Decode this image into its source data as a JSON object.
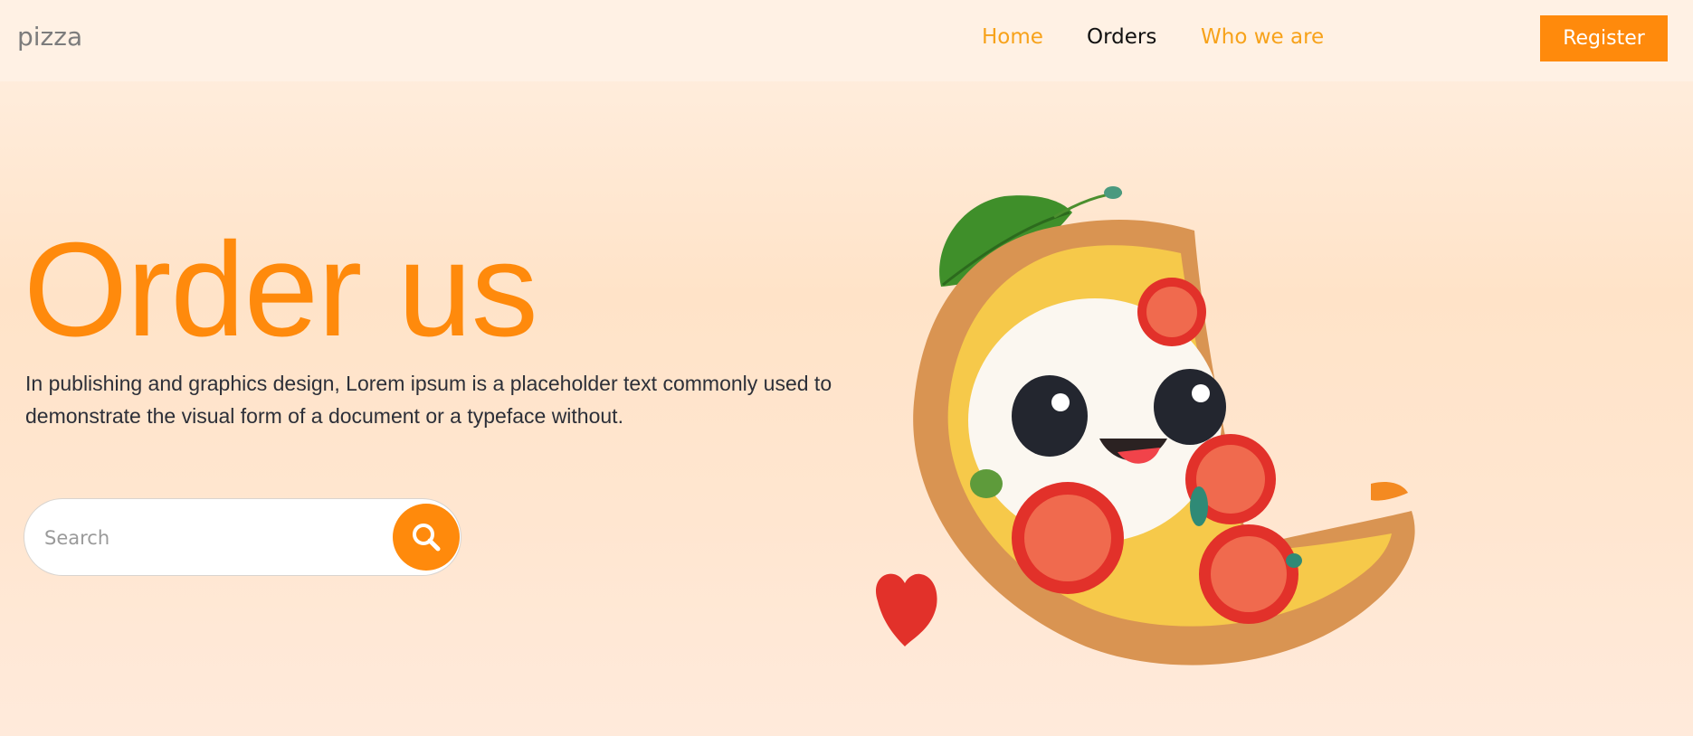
{
  "brand": {
    "name": "pizza"
  },
  "nav": {
    "home": "Home",
    "orders": "Orders",
    "who_we_are": "Who we are",
    "register": "Register"
  },
  "hero": {
    "title": "Order us",
    "description": "In publishing and graphics design, Lorem ipsum is a placeholder text commonly used to demonstrate the visual form of a document or a typeface without."
  },
  "search": {
    "placeholder": "Search",
    "value": "",
    "icon": "search-icon"
  },
  "illustration": {
    "icon": "pizza-illustration"
  },
  "colors": {
    "accent": "#ff8a0c",
    "nav_link": "#f7a21a",
    "nav_active": "#111111",
    "brand_text": "#7c7c7c",
    "background": "#ffe3c8"
  }
}
